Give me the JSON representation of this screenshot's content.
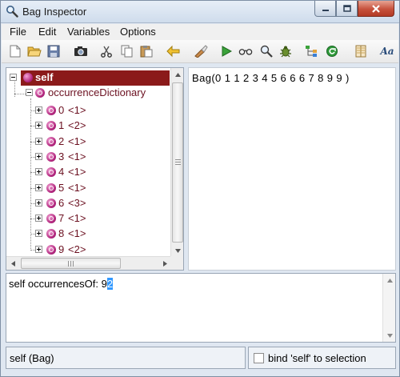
{
  "window": {
    "title": "Bag Inspector"
  },
  "menu": [
    "File",
    "Edit",
    "Variables",
    "Options"
  ],
  "toolbar": {
    "icons": [
      "new-document-icon",
      "open-folder-icon",
      "save-icon",
      "camera-icon",
      "cut-icon",
      "copy-icon",
      "paste-icon",
      "back-arrow-icon",
      "inspect-icon",
      "run-icon",
      "glasses-icon",
      "search-icon",
      "debug-bug-icon",
      "tree-icon",
      "refresh-icon",
      "columns-icon",
      "font-icon"
    ],
    "font_label": "Aa"
  },
  "tree": {
    "root": {
      "label": "self"
    },
    "child": {
      "label": "occurrenceDictionary"
    },
    "items": [
      {
        "key": "0",
        "value": "<1>"
      },
      {
        "key": "1",
        "value": "<2>"
      },
      {
        "key": "2",
        "value": "<1>"
      },
      {
        "key": "3",
        "value": "<1>"
      },
      {
        "key": "4",
        "value": "<1>"
      },
      {
        "key": "5",
        "value": "<1>"
      },
      {
        "key": "6",
        "value": "<3>"
      },
      {
        "key": "7",
        "value": "<1>"
      },
      {
        "key": "8",
        "value": "<1>"
      },
      {
        "key": "9",
        "value": "<2>"
      }
    ]
  },
  "value_pane": {
    "text": "Bag(0 1 1 2 3 4 5 6 6 6 7 8 9 9 )"
  },
  "code_pane": {
    "prefix": "self occurrencesOf: 9",
    "selection": "2"
  },
  "status": {
    "left": "self (Bag)",
    "checkbox_label": "bind 'self' to selection"
  },
  "colors": {
    "selection": "#8b1a1a",
    "text_selection": "#3399ff",
    "node_icon": "#b1247c"
  }
}
